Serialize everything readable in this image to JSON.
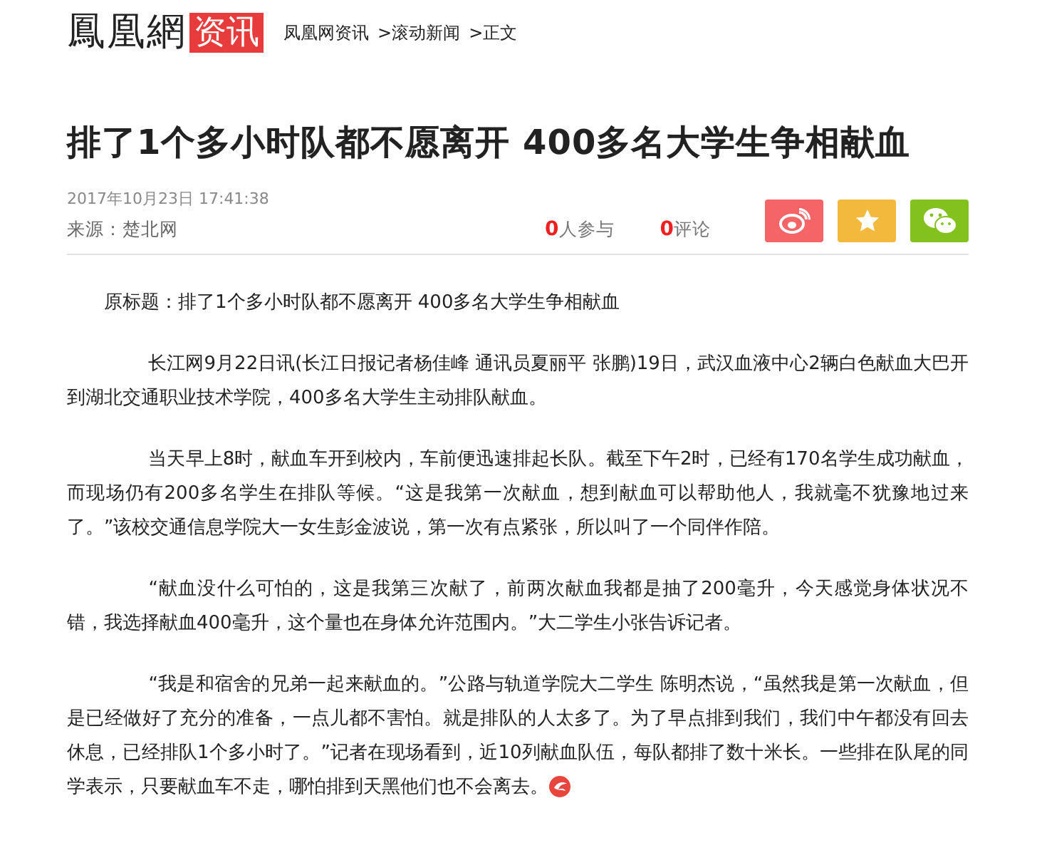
{
  "header": {
    "logo": "鳳凰網",
    "channel": "资讯",
    "breadcrumb": [
      "凤凰网资讯",
      ">滚动新闻",
      ">正文"
    ]
  },
  "article": {
    "title": "排了1个多小时队都不愿离开  400多名大学生争相献血",
    "datetime": "2017年10月23日  17:41:38",
    "source": "来源：楚北网",
    "stats": [
      {
        "count": "0",
        "label": "人参与"
      },
      {
        "count": "0",
        "label": "评论"
      }
    ],
    "share": [
      {
        "kind": "weibo",
        "color": "#f56467"
      },
      {
        "kind": "favorite",
        "color": "#f3b93c"
      },
      {
        "kind": "wechat",
        "color": "#83c21e"
      }
    ],
    "paragraphs": [
      {
        "text": "原标题：排了1个多小时队都不愿离开 400多名大学生争相献血",
        "indent": false
      },
      {
        "text": "长江网9月22日讯(长江日报记者杨佳峰 通讯员夏丽平  张鹏)19日，武汉血液中心2辆白色献血大巴开到湖北交通职业技术学院，400多名大学生主动排队献血。",
        "indent": true
      },
      {
        "text": "当天早上8时，献血车开到校内，车前便迅速排起长队。截至下午2时，已经有170名学生成功献血，而现场仍有200多名学生在排队等候。“这是我第一次献血，想到献血可以帮助他人，我就毫不犹豫地过来了。”该校交通信息学院大一女生彭金波说，第一次有点紧张，所以叫了一个同伴作陪。",
        "indent": true
      },
      {
        "text": "“献血没什么可怕的，这是我第三次献了，前两次献血我都是抽了200毫升，今天感觉身体状况不错，我选择献血400毫升，这个量也在身体允许范围内。”大二学生小张告诉记者。",
        "indent": true
      },
      {
        "text": "“我是和宿舍的兄弟一起来献血的。”公路与轨道学院大二学生 陈明杰说，“虽然我是第一次献血，但是已经做好了充分的准备，一点儿都不害怕。就是排队的人太多了。为了早点排到我们，我们中午都没有回去休息，已经排队1个多小时了。”记者在现场看到，近10列献血队伍，每队都排了数十米长。一些排在队尾的同学表示，只要献血车不走，哪怕排到天黑他们也不会离去。",
        "indent": true,
        "end_mark": true
      }
    ]
  }
}
